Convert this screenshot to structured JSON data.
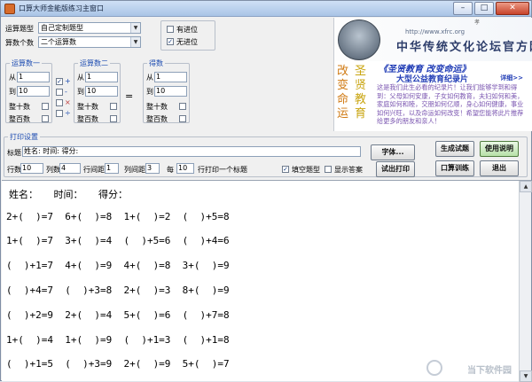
{
  "window": {
    "title": "口算大师金能版练习主窗口",
    "btn_min": "–",
    "btn_max": "□",
    "btn_close": "✕"
  },
  "settings": {
    "op_type_label": "运算题型",
    "op_type_value": "自己定制题型",
    "count_label": "算数个数",
    "count_value": "二个运算数",
    "carry_label": "有进位",
    "borrow_label": "无进位",
    "carry_checked": false,
    "borrow_checked": true
  },
  "groups": {
    "num1": {
      "title": "运算数一",
      "from_label": "从",
      "from": "1",
      "to_label": "到",
      "to": "10",
      "tens": "整十数",
      "hundreds": "整百数"
    },
    "ops": {
      "plus": "+",
      "minus": "-",
      "times": "×",
      "divide": "÷",
      "plus_checked": true
    },
    "num2": {
      "title": "运算数二",
      "from_label": "从",
      "from": "1",
      "to_label": "到",
      "to": "10",
      "tens": "整十数",
      "hundreds": "整百数"
    },
    "equals": "=",
    "result": {
      "title": "得数",
      "from_label": "从",
      "from": "1",
      "to_label": "到",
      "to": "10",
      "tens": "整十数",
      "hundreds": "整百数"
    }
  },
  "print": {
    "section_title": "打印设置",
    "title_label": "标题",
    "title_value": "姓名:        时间:         得分:",
    "rows_label": "行数",
    "rows": "10",
    "cols_label": "列数",
    "cols": "4",
    "row_gap_label": "行间距",
    "row_gap": "1",
    "col_gap_label": "列间距",
    "col_gap": "3",
    "each_label": "每",
    "each": "10",
    "each_suffix": "行打印一个标题",
    "fill_label": "填空题型",
    "fill_checked": true,
    "show_answer_label": "显示答案",
    "show_answer_checked": false
  },
  "buttons": {
    "font": "字体...",
    "generate": "生成试题",
    "help": "使用说明",
    "print": "试出打印",
    "drill": "口算训练",
    "exit": "退出"
  },
  "banner": {
    "cal_top": "孝",
    "site": "http://www.xfrc.org",
    "title": "中华传统文化论坛官方网",
    "vert1": [
      "改",
      "变",
      "命",
      "运"
    ],
    "vert2": [
      "圣",
      "贤",
      "教",
      "育"
    ],
    "film_title": "《圣贤教育 改变命运》",
    "film_sub": "大型公益教育纪录片",
    "detail": "详细>>",
    "text": "这是我们此生必看的纪录片！让我们能够学到和得到：父母如何安康，子女如何教育，夫妇如何和美，家庭如何和睦，交朋如何亿顺，身心如何健康，事业如何兴旺，以及命运如何改变！希望您能将此片推荐给更多的朋友和亲人！"
  },
  "worksheet": {
    "header": "姓名：     时间：     得分：",
    "rows": [
      "2+(  )=7  6+(  )=8  1+(  )=2  (  )+5=8",
      "1+(  )=7  3+(  )=4  (  )+5=6  (  )+4=6",
      "(  )+1=7  4+(  )=9  4+(  )=8  3+(  )=9",
      "(  )+4=7  (  )+3=8  2+(  )=3  8+(  )=9",
      "(  )+2=9  2+(  )=4  5+(  )=6  (  )+7=8",
      "1+(  )=4  1+(  )=9  (  )+1=3  (  )+1=8",
      "(  )+1=5  (  )+3=9  2+(  )=9  5+(  )=7"
    ],
    "watermark": "当下软件园"
  }
}
